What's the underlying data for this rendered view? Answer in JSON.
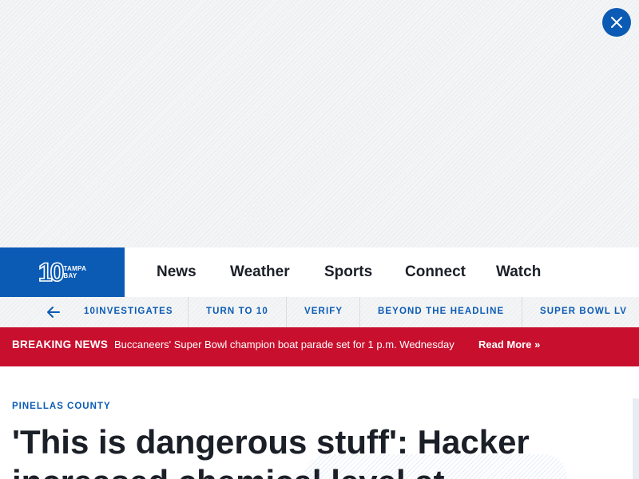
{
  "header": {
    "logo": {
      "number": "10",
      "line1": "TAMPA",
      "line2": "BAY"
    },
    "nav": [
      "News",
      "Weather",
      "Sports",
      "Connect",
      "Watch"
    ]
  },
  "subnav": [
    "10INVESTIGATES",
    "TURN TO 10",
    "VERIFY",
    "BEYOND THE HEADLINE",
    "SUPER BOWL LV"
  ],
  "breaking": {
    "label": "BREAKING NEWS",
    "text": "Buccaneers' Super Bowl champion boat parade set for 1 p.m. Wednesday",
    "link": "Read More »"
  },
  "article": {
    "category": "PINELLAS COUNTY",
    "headline": "'This is dangerous stuff': Hacker increased chemical level at"
  },
  "colors": {
    "brand_blue": "#0b5bb5",
    "breaking_red": "#c8102e",
    "text_dark": "#1b1f27"
  }
}
